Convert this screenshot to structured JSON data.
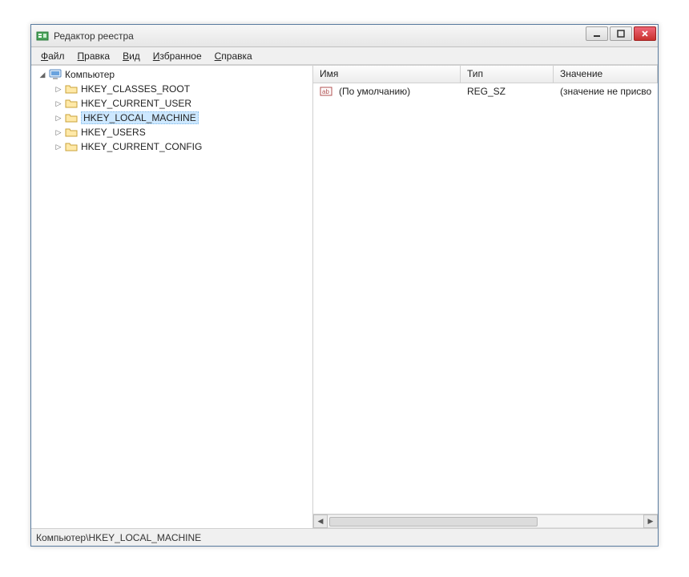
{
  "window": {
    "title": "Редактор реестра"
  },
  "menu": {
    "file": {
      "label": "Файл",
      "accel": "Ф"
    },
    "edit": {
      "label": "Правка",
      "accel": "П"
    },
    "view": {
      "label": "Вид",
      "accel": "В"
    },
    "favorites": {
      "label": "Избранное",
      "accel": "И"
    },
    "help": {
      "label": "Справка",
      "accel": "С"
    }
  },
  "tree": {
    "root": {
      "label": "Компьютер",
      "expanded": true
    },
    "items": [
      {
        "label": "HKEY_CLASSES_ROOT",
        "selected": false
      },
      {
        "label": "HKEY_CURRENT_USER",
        "selected": false
      },
      {
        "label": "HKEY_LOCAL_MACHINE",
        "selected": true
      },
      {
        "label": "HKEY_USERS",
        "selected": false
      },
      {
        "label": "HKEY_CURRENT_CONFIG",
        "selected": false
      }
    ]
  },
  "list": {
    "columns": {
      "name": "Имя",
      "type": "Тип",
      "value": "Значение"
    },
    "rows": [
      {
        "name": "(По умолчанию)",
        "type": "REG_SZ",
        "value": "(значение не присво"
      }
    ]
  },
  "status": {
    "path": "Компьютер\\HKEY_LOCAL_MACHINE"
  },
  "icons": {
    "app": "regedit-icon",
    "computer": "computer-icon",
    "folder": "folder-icon",
    "string_value": "string-value-icon"
  }
}
